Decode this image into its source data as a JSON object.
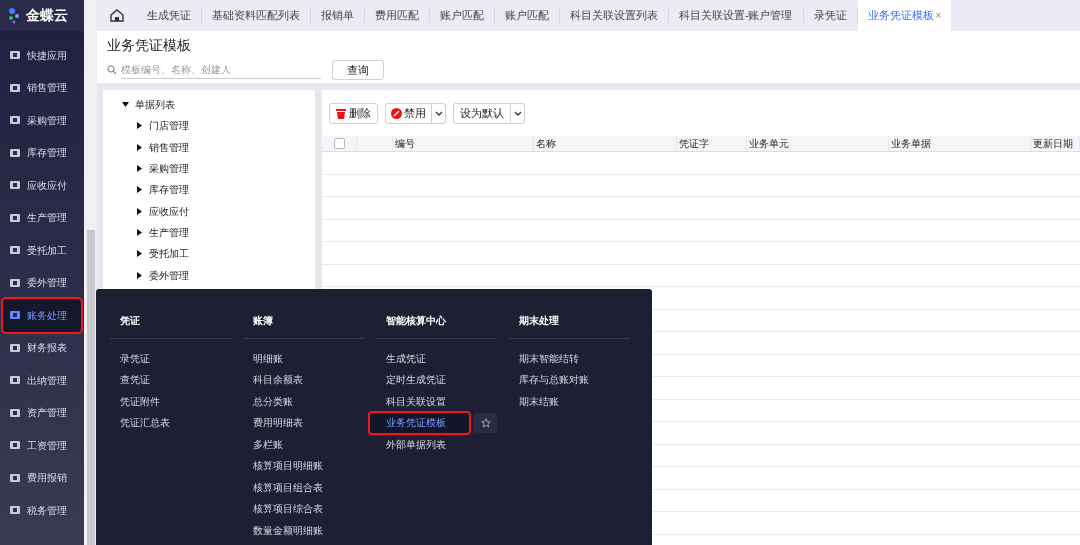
{
  "brand": "金蝶云",
  "tabs": [
    {
      "label": "生成凭证",
      "selected": false
    },
    {
      "label": "基础资料匹配列表",
      "selected": false
    },
    {
      "label": "报销单",
      "selected": false
    },
    {
      "label": "费用匹配",
      "selected": false
    },
    {
      "label": "账户匹配",
      "selected": false
    },
    {
      "label": "账户匹配",
      "selected": false
    },
    {
      "label": "科目关联设置列表",
      "selected": false
    },
    {
      "label": "科目关联设置-账户管理",
      "selected": false
    },
    {
      "label": "录凭证",
      "selected": false
    },
    {
      "label": "业务凭证模板",
      "selected": true,
      "close": "×"
    }
  ],
  "sidebar": {
    "items": [
      {
        "label": "快捷应用",
        "selected": false,
        "highlighted": false
      },
      {
        "label": "销售管理",
        "selected": false,
        "highlighted": false
      },
      {
        "label": "采购管理",
        "selected": false,
        "highlighted": false
      },
      {
        "label": "库存管理",
        "selected": false,
        "highlighted": false
      },
      {
        "label": "应收应付",
        "selected": false,
        "highlighted": false
      },
      {
        "label": "生产管理",
        "selected": false,
        "highlighted": false
      },
      {
        "label": "受托加工",
        "selected": false,
        "highlighted": false
      },
      {
        "label": "委外管理",
        "selected": false,
        "highlighted": false
      },
      {
        "label": "账务处理",
        "selected": true,
        "highlighted": true
      },
      {
        "label": "财务报表",
        "selected": false,
        "highlighted": false
      },
      {
        "label": "出纳管理",
        "selected": false,
        "highlighted": false
      },
      {
        "label": "资产管理",
        "selected": false,
        "highlighted": false
      },
      {
        "label": "工资管理",
        "selected": false,
        "highlighted": false
      },
      {
        "label": "费用报销",
        "selected": false,
        "highlighted": false
      },
      {
        "label": "税务管理",
        "selected": false,
        "highlighted": false
      }
    ]
  },
  "page_title": "业务凭证模板",
  "search": {
    "placeholder": "模板编号、名称、创建人",
    "button": "查询"
  },
  "tree": {
    "label": "单据列表",
    "expanded": true,
    "children": [
      {
        "label": "门店管理",
        "expanded": false
      },
      {
        "label": "销售管理",
        "expanded": false
      },
      {
        "label": "采购管理",
        "expanded": false
      },
      {
        "label": "库存管理",
        "expanded": false
      },
      {
        "label": "应收应付",
        "expanded": false
      },
      {
        "label": "生产管理",
        "expanded": false
      },
      {
        "label": "受托加工",
        "expanded": false
      },
      {
        "label": "委外管理",
        "expanded": false
      }
    ]
  },
  "toolbar": {
    "delete": "删除",
    "disable": "禁用",
    "set_default": "设为默认"
  },
  "table": {
    "columns": [
      "编号",
      "名称",
      "凭证字",
      "业务单元",
      "业务单据",
      "更新日期"
    ],
    "checked": false
  },
  "menu": {
    "groups": [
      {
        "title": "凭证",
        "items": [
          {
            "label": "录凭证",
            "selected": false
          },
          {
            "label": "查凭证",
            "selected": false
          },
          {
            "label": "凭证附件",
            "selected": false
          },
          {
            "label": "凭证汇总表",
            "selected": false
          }
        ]
      },
      {
        "title": "账簿",
        "items": [
          {
            "label": "明细账",
            "selected": false
          },
          {
            "label": "科目余额表",
            "selected": false
          },
          {
            "label": "总分类账",
            "selected": false
          },
          {
            "label": "费用明细表",
            "selected": false
          },
          {
            "label": "多栏账",
            "selected": false
          },
          {
            "label": "核算项目明细账",
            "selected": false
          },
          {
            "label": "核算项目组合表",
            "selected": false
          },
          {
            "label": "核算项目综合表",
            "selected": false
          },
          {
            "label": "数量金额明细账",
            "selected": false
          }
        ]
      },
      {
        "title": "智能核算中心",
        "items": [
          {
            "label": "生成凭证",
            "selected": false
          },
          {
            "label": "定时生成凭证",
            "selected": false
          },
          {
            "label": "科目关联设置",
            "selected": false
          },
          {
            "label": "业务凭证模板",
            "selected": true,
            "highlighted": true
          },
          {
            "label": "外部单据列表",
            "selected": false
          }
        ]
      },
      {
        "title": "期末处理",
        "items": [
          {
            "label": "期末智能结转",
            "selected": false
          },
          {
            "label": "库存与总账对账",
            "selected": false
          },
          {
            "label": "期末结账",
            "selected": false
          }
        ]
      }
    ]
  }
}
